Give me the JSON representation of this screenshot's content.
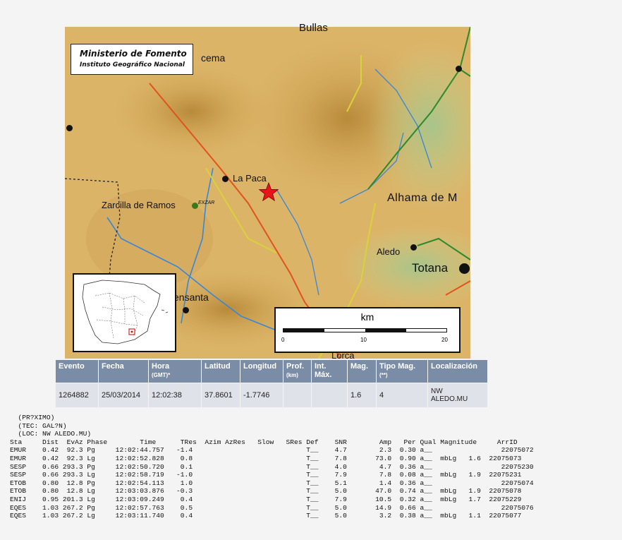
{
  "map": {
    "logo": {
      "line1": "Ministerio de Fomento",
      "line2": "Instituto Geográfico Nacional"
    },
    "places": {
      "bullas": "Bullas",
      "cema": "cema",
      "la_paca": "La Paca",
      "zarcilla": "Zarcilla de Ramos",
      "station": "EXZAR",
      "alhama": "Alhama de M",
      "aledo": "Aledo",
      "totana": "Totana",
      "bensanta": "ensanta",
      "lorca": "Lorca"
    },
    "scale": {
      "unit": "km",
      "ticks": [
        "0",
        "10",
        "20"
      ]
    },
    "colors": {
      "epicenter": "#e8141a",
      "river": "#3a86d6",
      "road_red": "#e0541c",
      "road_yellow": "#d9d23a",
      "road_green": "#2c8a2c"
    }
  },
  "event_table": {
    "headers": {
      "evento": "Evento",
      "fecha": "Fecha",
      "hora": "Hora",
      "hora_sub": "(GMT)*",
      "latitud": "Latitud",
      "longitud": "Longitud",
      "prof": "Prof.",
      "prof_sub": "(km)",
      "int": "Int.",
      "int_sub": "Máx.",
      "mag": "Mag.",
      "tipo": "Tipo Mag.",
      "tipo_sub": "(**)",
      "loc": "Localización"
    },
    "row": {
      "evento": "1264882",
      "fecha": "25/03/2014",
      "hora": "12:02:38",
      "latitud": "37.8601",
      "longitud": "-1.7746",
      "prof": "",
      "int": "",
      "mag": "1.6",
      "tipo": "4",
      "loc1": "NW",
      "loc2": "ALEDO.MU"
    }
  },
  "report": {
    "lines": [
      "  (PR?XIMO)",
      "  (TEC: GAL?N)",
      "  (LOC: NW ALEDO.MU)",
      "Sta     Dist  EvAz Phase        Time      TRes  Azim AzRes   Slow   SRes Def    SNR        Amp   Per Qual Magnitude     ArrID",
      "EMUR    0.42  92.3 Pg     12:02:44.757   -1.4                            T__    4.7        2.3  0.30 a__                 22075072",
      "EMUR    0.42  92.3 Lg     12:02:52.828    0.8                            T__    7.8       73.0  0.90 a__  mbLg   1.6  22075073",
      "SESP    0.66 293.3 Pg     12:02:50.720    0.1                            T__    4.0        4.7  0.36 a__                 22075230",
      "SESP    0.66 293.3 Lg     12:02:58.719   -1.0                            T__    7.9        7.8  0.08 a__  mbLg   1.9  22075231",
      "ETOB    0.80  12.8 Pg     12:02:54.113    1.0                            T__    5.1        1.4  0.36 a__                 22075074",
      "ETOB    0.80  12.8 Lg     12:03:03.876   -0.3                            T__    5.0       47.0  0.74 a__  mbLg   1.9  22075078",
      "ENIJ    0.95 201.3 Lg     12:03:09.249    0.4                            T__    7.9       10.5  0.32 a__  mbLg   1.7  22075229",
      "EQES    1.03 267.2 Pg     12:02:57.763    0.5                            T__    5.0       14.9  0.66 a__                 22075076",
      "EQES    1.03 267.2 Lg     12:03:11.740    0.4                            T__    5.0        3.2  0.38 a__  mbLg   1.1  22075077"
    ]
  }
}
